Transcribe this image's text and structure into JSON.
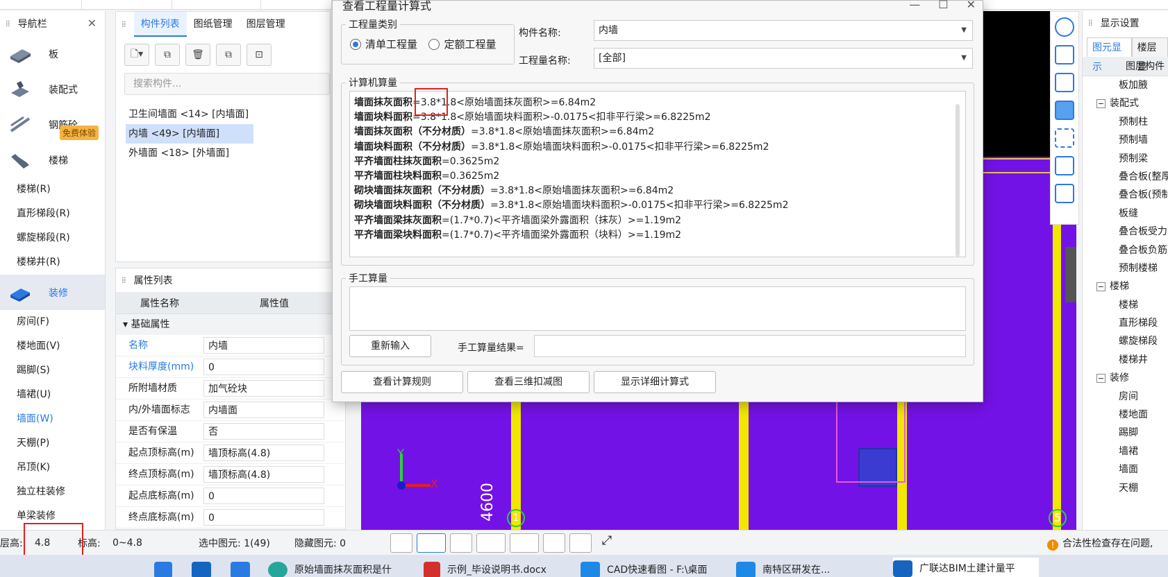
{
  "nav": {
    "title": "导航栏",
    "groups": [
      {
        "label": "板"
      },
      {
        "label": "装配式"
      },
      {
        "label": "钢筋砼"
      },
      {
        "label": "楼梯"
      }
    ],
    "stairs_items": [
      "楼梯(R)",
      "直形梯段(R)",
      "螺旋梯段(R)",
      "楼梯井(R)"
    ],
    "decor_group": "装修",
    "decor_items": [
      "房间(F)",
      "楼地面(V)",
      "踢脚(S)",
      "墙裙(U)",
      "墙面(W)",
      "天棚(P)",
      "吊顶(K)",
      "独立柱装修",
      "单梁装修"
    ],
    "promo": "免费体验"
  },
  "component_list": {
    "tabs": [
      "构件列表",
      "图纸管理",
      "图层管理"
    ],
    "search_placeholder": "搜索构件...",
    "items": [
      "卫生间墙面 <14> [内墙面]",
      "内墙 <49> [内墙面]",
      "外墙面 <18> [外墙面]"
    ]
  },
  "property_list": {
    "title": "属性列表",
    "col_name": "属性名称",
    "col_value": "属性值",
    "section": "基础属性",
    "rows": [
      {
        "k": "名称",
        "v": "内墙"
      },
      {
        "k": "块料厚度(mm)",
        "v": "0"
      },
      {
        "k": "所附墙材质",
        "v": "加气砼块"
      },
      {
        "k": "内/外墙面标志",
        "v": "内墙面"
      },
      {
        "k": "是否有保温",
        "v": "否"
      },
      {
        "k": "起点顶标高(m)",
        "v": "墙顶标高(4.8)"
      },
      {
        "k": "终点顶标高(m)",
        "v": "墙顶标高(4.8)"
      },
      {
        "k": "起点底标高(m)",
        "v": "0"
      },
      {
        "k": "终点底标高(m)",
        "v": "0"
      }
    ]
  },
  "dialog": {
    "title": "查看工程量计算式",
    "qty_type_legend": "工程量类别",
    "radio_list": "清单工程量",
    "radio_quota": "定额工程量",
    "comp_name_label": "构件名称:",
    "comp_name_value": "内墙",
    "qty_name_label": "工程量名称:",
    "qty_name_value": "[全部]",
    "calc_legend": "计算机算量",
    "calc_lines": [
      {
        "name": "墙面抹灰面积",
        "expr": "=3.8*1.8<原始墙面抹灰面积>=6.84m2"
      },
      {
        "name": "墙面块料面积",
        "expr": "=3.8*1.8<原始墙面块料面积>-0.0175<扣非平行梁>=6.8225m2"
      },
      {
        "name": "墙面抹灰面积（不分材质）",
        "expr": "=3.8*1.8<原始墙面抹灰面积>=6.84m2"
      },
      {
        "name": "墙面块料面积（不分材质）",
        "expr": "=3.8*1.8<原始墙面块料面积>-0.0175<扣非平行梁>=6.8225m2"
      },
      {
        "name": "平齐墙面柱抹灰面积",
        "expr": "=0.3625m2"
      },
      {
        "name": "平齐墙面柱块料面积",
        "expr": "=0.3625m2"
      },
      {
        "name": "砌块墙面抹灰面积（不分材质）",
        "expr": "=3.8*1.8<原始墙面抹灰面积>=6.84m2"
      },
      {
        "name": "砌块墙面块料面积（不分材质）",
        "expr": "=3.8*1.8<原始墙面块料面积>-0.0175<扣非平行梁>=6.8225m2"
      },
      {
        "name": "平齐墙面梁抹灰面积",
        "expr": "=(1.7*0.7)<平齐墙面梁外露面积（抹灰）>=1.19m2"
      },
      {
        "name": "平齐墙面梁块料面积",
        "expr": "=(1.7*0.7)<平齐墙面梁外露面积（块料）>=1.19m2"
      }
    ],
    "manual_legend": "手工算量",
    "reenter": "重新输入",
    "manual_result_label": "手工算量结果=",
    "btn_rules": "查看计算规则",
    "btn_3d": "查看三维扣减图",
    "btn_detail": "显示详细计算式"
  },
  "right_panel": {
    "title": "显示设置",
    "tab1": "图元显示",
    "tab2": "楼层显",
    "col": "图层构件",
    "items": [
      {
        "t": "板加腋",
        "g": false
      },
      {
        "t": "装配式",
        "g": true
      },
      {
        "t": "预制柱",
        "g": false
      },
      {
        "t": "预制墙",
        "g": false
      },
      {
        "t": "预制梁",
        "g": false
      },
      {
        "t": "叠合板(整厚",
        "g": false
      },
      {
        "t": "叠合板(预制",
        "g": false
      },
      {
        "t": "板缝",
        "g": false
      },
      {
        "t": "叠合板受力",
        "g": false
      },
      {
        "t": "叠合板负筋",
        "g": false
      },
      {
        "t": "预制楼梯",
        "g": false
      },
      {
        "t": "楼梯",
        "g": true
      },
      {
        "t": "楼梯",
        "g": false
      },
      {
        "t": "直形梯段",
        "g": false
      },
      {
        "t": "螺旋梯段",
        "g": false
      },
      {
        "t": "楼梯井",
        "g": false
      },
      {
        "t": "装修",
        "g": true
      },
      {
        "t": "房间",
        "g": false
      },
      {
        "t": "楼地面",
        "g": false
      },
      {
        "t": "踢脚",
        "g": false
      },
      {
        "t": "墙裙",
        "g": false
      },
      {
        "t": "墙面",
        "g": false
      },
      {
        "t": "天棚",
        "g": false
      }
    ]
  },
  "canvas": {
    "dim_label": "4600",
    "axis_y": "Y",
    "axis_x": "X",
    "grid_1": "1",
    "grid_5": "5"
  },
  "status": {
    "floor_h_label": "层高:",
    "floor_h_value": "4.8",
    "elev_label": "标高:",
    "elev_value": "0~4.8",
    "selected": "选中图元: 1(49)",
    "hidden": "隐藏图元: 0",
    "warning": "合法性检查存在问题,"
  },
  "taskbar": {
    "items": [
      "原始墙面抹灰面积是什",
      "示例_毕设说明书.docx",
      "CAD快速看图 - F:\\桌面",
      "南特区研发在...",
      "广联达BIM土建计量平"
    ]
  },
  "colors": {
    "accent": "#2a7ae2",
    "canvas": "#7312e6",
    "highlight": "#e02020"
  }
}
